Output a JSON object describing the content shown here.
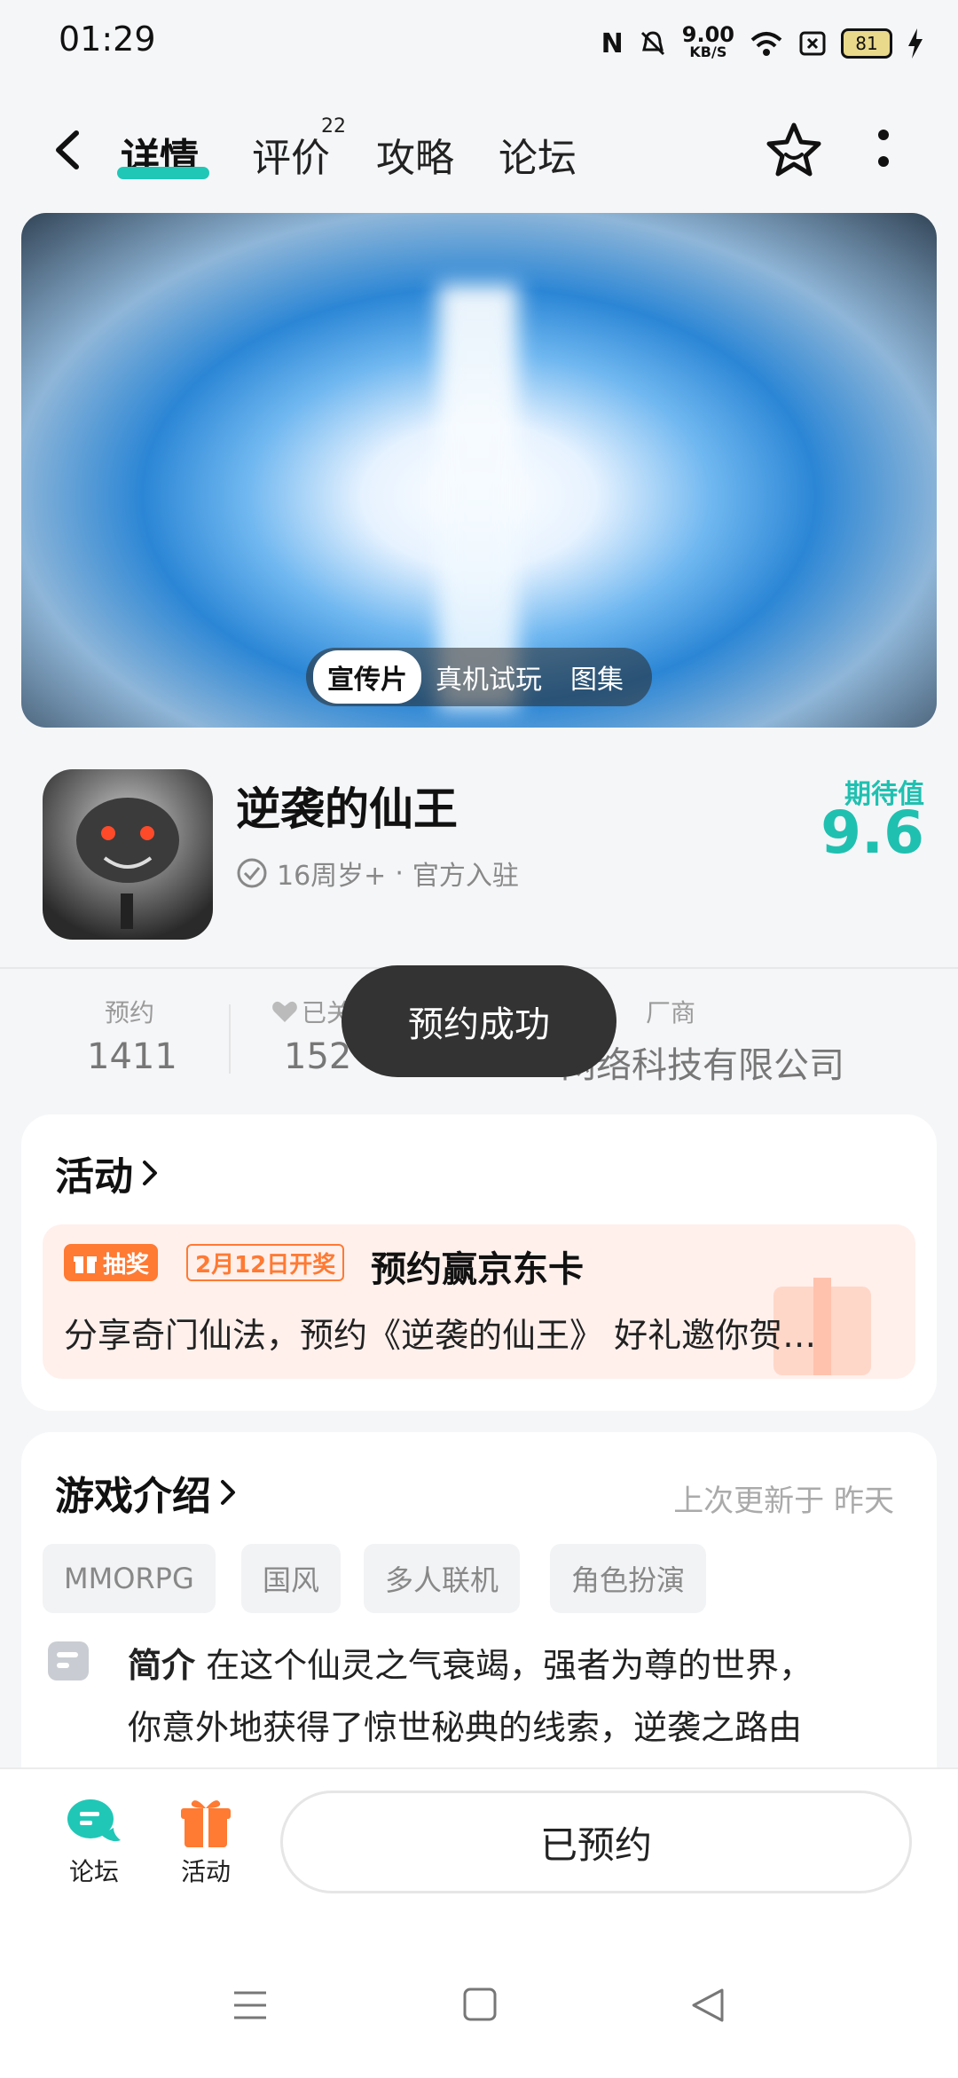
{
  "status_bar": {
    "time": "01:29",
    "speed_value": "9.00",
    "speed_unit": "KB/S",
    "battery": "81"
  },
  "nav": {
    "tabs": [
      {
        "label": "详情"
      },
      {
        "label": "评价",
        "badge": "22"
      },
      {
        "label": "攻略"
      },
      {
        "label": "论坛"
      }
    ]
  },
  "media": {
    "segments": [
      "宣传片",
      "真机试玩",
      "图集"
    ]
  },
  "game": {
    "name": "逆袭的仙王",
    "age": "16周岁+",
    "official": "官方入驻",
    "expect_label": "期待值",
    "expect_value": "9.6"
  },
  "stats": {
    "reserve_label": "预约",
    "reserve_value": "1411",
    "follow_label": "已关",
    "follow_value": "152",
    "vendor_label": "厂商",
    "vendor_value": "网络科技有限公司"
  },
  "toast": "预约成功",
  "activity": {
    "title": "活动",
    "tag_lottery": "抽奖",
    "tag_date": "2月12日开奖",
    "promo_title": "预约赢京东卡",
    "promo_desc": "分享奇门仙法，预约《逆袭的仙王》 好礼邀你贺…"
  },
  "intro": {
    "title": "游戏介绍",
    "updated": "上次更新于 昨天",
    "tags": [
      "MMORPG",
      "国风",
      "多人联机",
      "角色扮演"
    ],
    "summary_label": "简介",
    "summary_line1": "在这个仙灵之气衰竭，强者为尊的世界，",
    "summary_line2": "你意外地获得了惊世秘典的线索，逆袭之路由"
  },
  "bottom": {
    "forum": "论坛",
    "activity": "活动",
    "reserved_button": "已预约"
  },
  "colors": {
    "accent": "#20c7b7",
    "orange": "#ff7a33"
  }
}
